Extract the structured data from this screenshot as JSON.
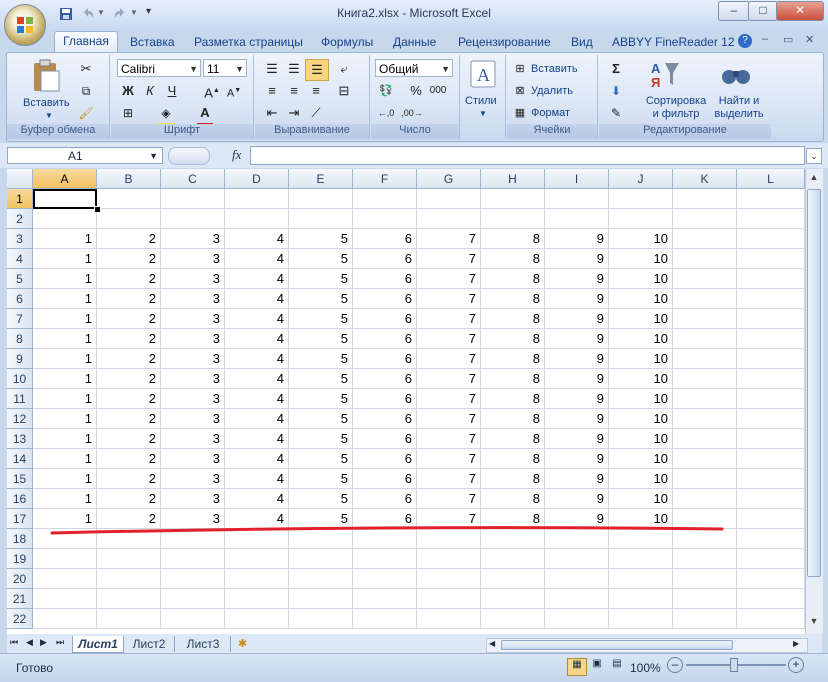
{
  "window": {
    "title": "Книга2.xlsx - Microsoft Excel",
    "min": "–",
    "max": "□",
    "close": "✕"
  },
  "tabs": [
    "Главная",
    "Вставка",
    "Разметка страницы",
    "Формулы",
    "Данные",
    "Рецензирование",
    "Вид",
    "ABBYY FineReader 12"
  ],
  "ribbon": {
    "clipboard": {
      "label": "Буфер обмена",
      "paste": "Вставить"
    },
    "font": {
      "label": "Шрифт",
      "name": "Calibri",
      "size": "11",
      "bold": "Ж",
      "italic": "К",
      "underline": "Ч"
    },
    "alignment": {
      "label": "Выравнивание"
    },
    "number": {
      "label": "Число",
      "format": "Общий",
      "percent": "%",
      "thousands": "000"
    },
    "styles": {
      "label": "Стили"
    },
    "cells": {
      "label": "Ячейки",
      "insert": "Вставить",
      "delete": "Удалить",
      "format": "Формат"
    },
    "editing": {
      "label": "Редактирование",
      "sort": "Сортировка\nи фильтр",
      "find": "Найти и\nвыделить",
      "sigma": "Σ"
    }
  },
  "formula_bar": {
    "name_box": "A1",
    "fx": "fx",
    "value": ""
  },
  "columns": [
    "A",
    "B",
    "C",
    "D",
    "E",
    "F",
    "G",
    "H",
    "I",
    "J",
    "K",
    "L"
  ],
  "rows": [
    "1",
    "2",
    "3",
    "4",
    "5",
    "6",
    "7",
    "8",
    "9",
    "10",
    "11",
    "12",
    "13",
    "14",
    "15",
    "16",
    "17",
    "18",
    "19",
    "20",
    "21",
    "22"
  ],
  "data_rows": [
    [
      "1",
      "2",
      "3",
      "4",
      "5",
      "6",
      "7",
      "8",
      "9",
      "10"
    ],
    [
      "1",
      "2",
      "3",
      "4",
      "5",
      "6",
      "7",
      "8",
      "9",
      "10"
    ],
    [
      "1",
      "2",
      "3",
      "4",
      "5",
      "6",
      "7",
      "8",
      "9",
      "10"
    ],
    [
      "1",
      "2",
      "3",
      "4",
      "5",
      "6",
      "7",
      "8",
      "9",
      "10"
    ],
    [
      "1",
      "2",
      "3",
      "4",
      "5",
      "6",
      "7",
      "8",
      "9",
      "10"
    ],
    [
      "1",
      "2",
      "3",
      "4",
      "5",
      "6",
      "7",
      "8",
      "9",
      "10"
    ],
    [
      "1",
      "2",
      "3",
      "4",
      "5",
      "6",
      "7",
      "8",
      "9",
      "10"
    ],
    [
      "1",
      "2",
      "3",
      "4",
      "5",
      "6",
      "7",
      "8",
      "9",
      "10"
    ],
    [
      "1",
      "2",
      "3",
      "4",
      "5",
      "6",
      "7",
      "8",
      "9",
      "10"
    ],
    [
      "1",
      "2",
      "3",
      "4",
      "5",
      "6",
      "7",
      "8",
      "9",
      "10"
    ],
    [
      "1",
      "2",
      "3",
      "4",
      "5",
      "6",
      "7",
      "8",
      "9",
      "10"
    ],
    [
      "1",
      "2",
      "3",
      "4",
      "5",
      "6",
      "7",
      "8",
      "9",
      "10"
    ],
    [
      "1",
      "2",
      "3",
      "4",
      "5",
      "6",
      "7",
      "8",
      "9",
      "10"
    ],
    [
      "1",
      "2",
      "3",
      "4",
      "5",
      "6",
      "7",
      "8",
      "9",
      "10"
    ],
    [
      "1",
      "2",
      "3",
      "4",
      "5",
      "6",
      "7",
      "8",
      "9",
      "10"
    ]
  ],
  "sheets": [
    "Лист1",
    "Лист2",
    "Лист3"
  ],
  "status": {
    "ready": "Готово",
    "zoom": "100%"
  },
  "colors": {
    "annotation_line": "#e0202a",
    "selected_header": "#f6cb77"
  }
}
